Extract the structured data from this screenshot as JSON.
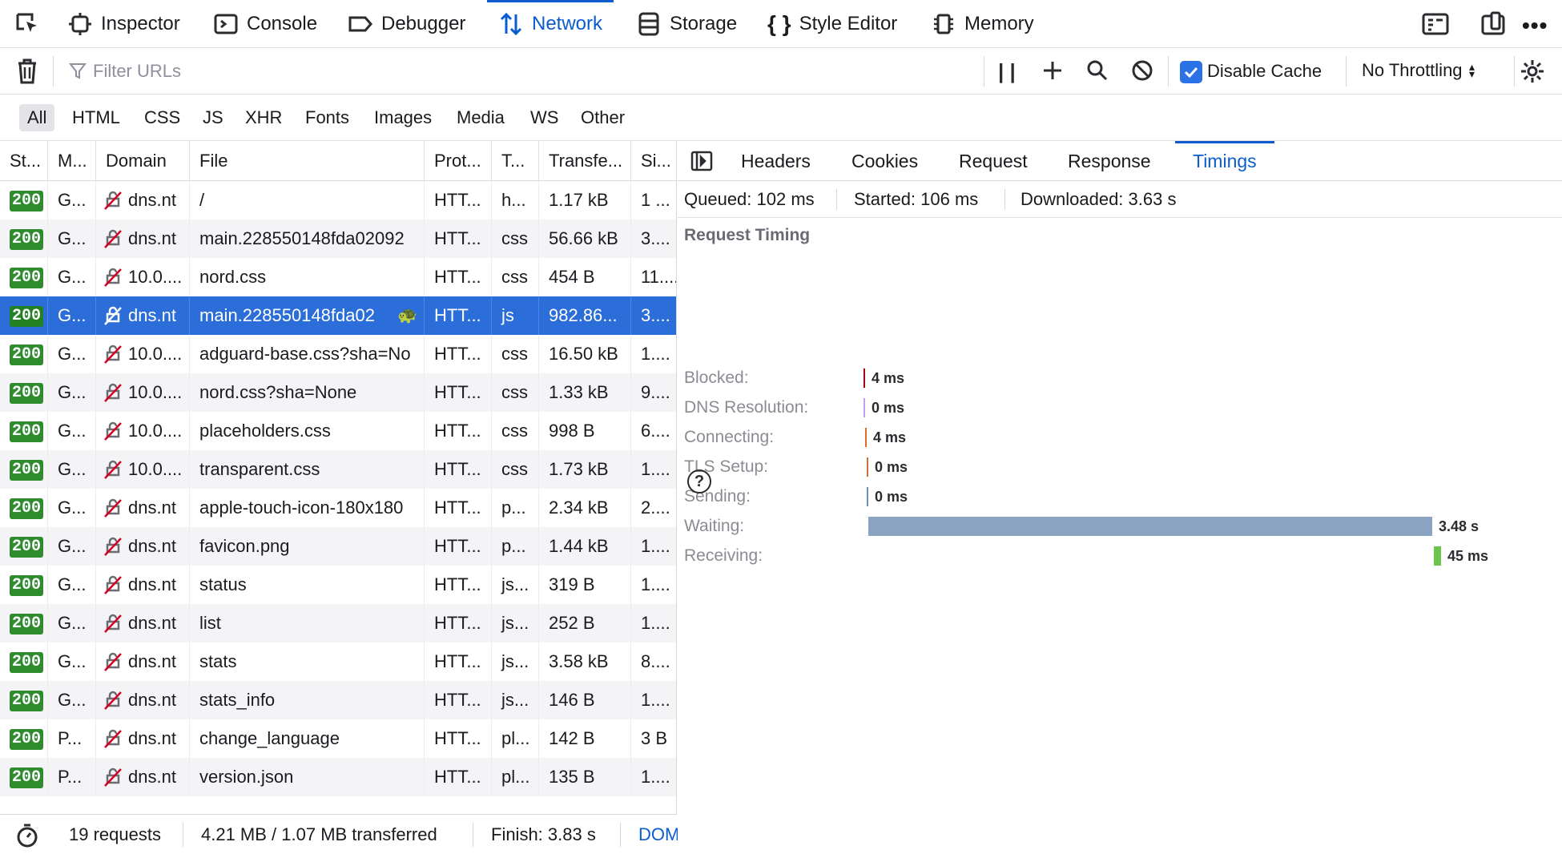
{
  "toolbox": {
    "tabs": [
      {
        "label": "Inspector",
        "icon": "inspector-icon"
      },
      {
        "label": "Console",
        "icon": "console-icon"
      },
      {
        "label": "Debugger",
        "icon": "debugger-icon"
      },
      {
        "label": "Network",
        "icon": "network-icon",
        "active": true
      },
      {
        "label": "Storage",
        "icon": "storage-icon"
      },
      {
        "label": "Style Editor",
        "icon": "style-editor-icon"
      },
      {
        "label": "Memory",
        "icon": "memory-icon"
      }
    ]
  },
  "toolbar": {
    "filter_placeholder": "Filter URLs",
    "disable_cache_label": "Disable Cache",
    "disable_cache_checked": true,
    "throttling_label": "No Throttling"
  },
  "type_filters": [
    "All",
    "HTML",
    "CSS",
    "JS",
    "XHR",
    "Fonts",
    "Images",
    "Media",
    "WS",
    "Other"
  ],
  "active_type_filter": "All",
  "table": {
    "columns": [
      "St...",
      "M...",
      "Domain",
      "File",
      "Prot...",
      "T...",
      "Transfe...",
      "Si..."
    ],
    "rows": [
      {
        "status": "200",
        "method": "G...",
        "domain": "dns.nt",
        "file": "/",
        "protocol": "HTT...",
        "type": "h...",
        "transferred": "1.17 kB",
        "size": "1 ..."
      },
      {
        "status": "200",
        "method": "G...",
        "domain": "dns.nt",
        "file": "main.228550148fda02092",
        "protocol": "HTT...",
        "type": "css",
        "transferred": "56.66 kB",
        "size": "3...."
      },
      {
        "status": "200",
        "method": "G...",
        "domain": "10.0....",
        "file": "nord.css",
        "protocol": "HTT...",
        "type": "css",
        "transferred": "454 B",
        "size": "11...."
      },
      {
        "status": "200",
        "method": "G...",
        "domain": "dns.nt",
        "file": "main.228550148fda02",
        "protocol": "HTT...",
        "type": "js",
        "transferred": "982.86...",
        "size": "3....",
        "selected": true
      },
      {
        "status": "200",
        "method": "G...",
        "domain": "10.0....",
        "file": "adguard-base.css?sha=No",
        "protocol": "HTT...",
        "type": "css",
        "transferred": "16.50 kB",
        "size": "1...."
      },
      {
        "status": "200",
        "method": "G...",
        "domain": "10.0....",
        "file": "nord.css?sha=None",
        "protocol": "HTT...",
        "type": "css",
        "transferred": "1.33 kB",
        "size": "9...."
      },
      {
        "status": "200",
        "method": "G...",
        "domain": "10.0....",
        "file": "placeholders.css",
        "protocol": "HTT...",
        "type": "css",
        "transferred": "998 B",
        "size": "6...."
      },
      {
        "status": "200",
        "method": "G...",
        "domain": "10.0....",
        "file": "transparent.css",
        "protocol": "HTT...",
        "type": "css",
        "transferred": "1.73 kB",
        "size": "1...."
      },
      {
        "status": "200",
        "method": "G...",
        "domain": "dns.nt",
        "file": "apple-touch-icon-180x180",
        "protocol": "HTT...",
        "type": "p...",
        "transferred": "2.34 kB",
        "size": "2...."
      },
      {
        "status": "200",
        "method": "G...",
        "domain": "dns.nt",
        "file": "favicon.png",
        "protocol": "HTT...",
        "type": "p...",
        "transferred": "1.44 kB",
        "size": "1...."
      },
      {
        "status": "200",
        "method": "G...",
        "domain": "dns.nt",
        "file": "status",
        "protocol": "HTT...",
        "type": "js...",
        "transferred": "319 B",
        "size": "1...."
      },
      {
        "status": "200",
        "method": "G...",
        "domain": "dns.nt",
        "file": "list",
        "protocol": "HTT...",
        "type": "js...",
        "transferred": "252 B",
        "size": "1...."
      },
      {
        "status": "200",
        "method": "G...",
        "domain": "dns.nt",
        "file": "stats",
        "protocol": "HTT...",
        "type": "js...",
        "transferred": "3.58 kB",
        "size": "8...."
      },
      {
        "status": "200",
        "method": "G...",
        "domain": "dns.nt",
        "file": "stats_info",
        "protocol": "HTT...",
        "type": "js...",
        "transferred": "146 B",
        "size": "1...."
      },
      {
        "status": "200",
        "method": "P...",
        "domain": "dns.nt",
        "file": "change_language",
        "protocol": "HTT...",
        "type": "pl...",
        "transferred": "142 B",
        "size": "3 B"
      },
      {
        "status": "200",
        "method": "P...",
        "domain": "dns.nt",
        "file": "version.json",
        "protocol": "HTT...",
        "type": "pl...",
        "transferred": "135 B",
        "size": "1...."
      }
    ]
  },
  "footer": {
    "requests": "19 requests",
    "transferred": "4.21 MB / 1.07 MB transferred",
    "finish": "Finish: 3.83 s",
    "dom_label": "DOM"
  },
  "details": {
    "tabs": [
      "Headers",
      "Cookies",
      "Request",
      "Response",
      "Timings"
    ],
    "active_tab": "Timings",
    "summary": {
      "queued": "Queued: 102 ms",
      "started": "Started: 106 ms",
      "downloaded": "Downloaded: 3.63 s"
    },
    "section_title": "Request Timing",
    "timings": [
      {
        "label": "Blocked:",
        "value": "4 ms",
        "color": "#a4000f"
      },
      {
        "label": "DNS Resolution:",
        "value": "0 ms",
        "color": "#c29cf7"
      },
      {
        "label": "Connecting:",
        "value": "4 ms",
        "color": "#e16b2d"
      },
      {
        "label": "TLS Setup:",
        "value": "0 ms",
        "color": "#c86e3a"
      },
      {
        "label": "Sending:",
        "value": "0 ms",
        "color": "#6c8fb1"
      },
      {
        "label": "Waiting:",
        "value": "3.48 s",
        "color": "#8aa3c1"
      },
      {
        "label": "Receiving:",
        "value": "45 ms",
        "color": "#6bc44b"
      }
    ],
    "help_label": "?"
  },
  "colors": {
    "accent": "#0a5ccf",
    "selected_row": "#2b6dd9",
    "status_ok": "#2e8b2e"
  }
}
